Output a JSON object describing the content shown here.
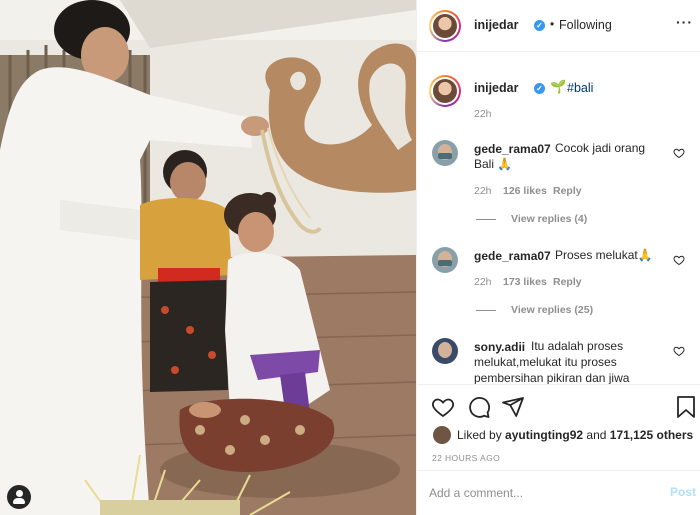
{
  "post": {
    "author": "inijedar",
    "follow_status": "Following",
    "caption_hashtag": "#bali",
    "caption_emoji": "plant-icon",
    "caption_time": "22h",
    "likes_by_user": "ayutingting92",
    "likes_others": "171,125 others",
    "likes_prefix": "Liked by",
    "likes_conj": "and",
    "posted_ago": "22 HOURS AGO",
    "add_comment_placeholder": "Add a comment...",
    "post_label": "Post"
  },
  "comments": [
    {
      "user": "gede_rama07",
      "text_line1": "Cocok jadi orang",
      "text_line2": "Bali 🙏",
      "time": "22h",
      "likes": "126 likes",
      "reply": "Reply",
      "view_replies": "View replies (4)"
    },
    {
      "user": "gede_rama07",
      "text_line1": "Proses melukat🙏",
      "time": "22h",
      "likes": "173 likes",
      "reply": "Reply",
      "view_replies": "View replies (25)"
    },
    {
      "user": "sony.adii",
      "text_line1": "Itu adalah proses",
      "text_line2": "melukat,melukat itu proses",
      "text_line3": "pembersihan pikiran dan jiwa"
    }
  ],
  "icons": {
    "verified": "verified-badge-icon",
    "more": "more-options-icon",
    "heart": "heart-icon",
    "comment": "comment-icon",
    "share": "share-icon",
    "bookmark": "bookmark-icon",
    "user_tag": "user-tag-icon"
  },
  "colors": {
    "verified": "#3897f0",
    "hashtag": "#00376b",
    "post_disabled": "#b2dffc",
    "muted": "#8e8e8e"
  }
}
